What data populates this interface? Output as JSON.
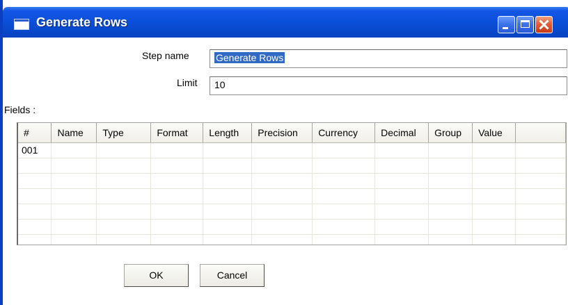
{
  "window": {
    "title": "Generate Rows"
  },
  "form": {
    "step_name_label": "Step name",
    "step_name_value": "Generate Rows",
    "limit_label": "Limit",
    "limit_value": "10",
    "fields_label": "Fields :"
  },
  "grid": {
    "columns": [
      "#",
      "Name",
      "Type",
      "Format",
      "Length",
      "Precision",
      "Currency",
      "Decimal",
      "Group",
      "Value"
    ],
    "rows": [
      [
        "001",
        "",
        "",
        "",
        "",
        "",
        "",
        "",
        "",
        ""
      ]
    ],
    "empty_rows": 6
  },
  "buttons": {
    "ok": "OK",
    "cancel": "Cancel"
  }
}
